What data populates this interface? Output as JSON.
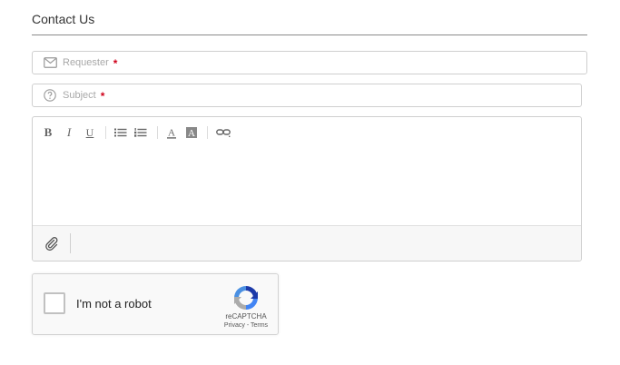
{
  "page": {
    "title": "Contact Us"
  },
  "form": {
    "requester": {
      "placeholder": "Requester",
      "required_mark": "*",
      "icon": "envelope-icon"
    },
    "subject": {
      "placeholder": "Subject",
      "required_mark": "*",
      "icon": "question-circle-icon"
    },
    "toolbar": {
      "bold": "B",
      "italic": "I",
      "underline": "U",
      "font_color": "A",
      "background_color": "A"
    }
  },
  "recaptcha": {
    "label": "I'm not a robot",
    "brand": "reCAPTCHA",
    "privacy": "Privacy",
    "separator": "-",
    "terms": "Terms"
  },
  "colors": {
    "required": "#d0021b",
    "border": "#cfcfcf",
    "placeholder": "#a8a8a8"
  }
}
